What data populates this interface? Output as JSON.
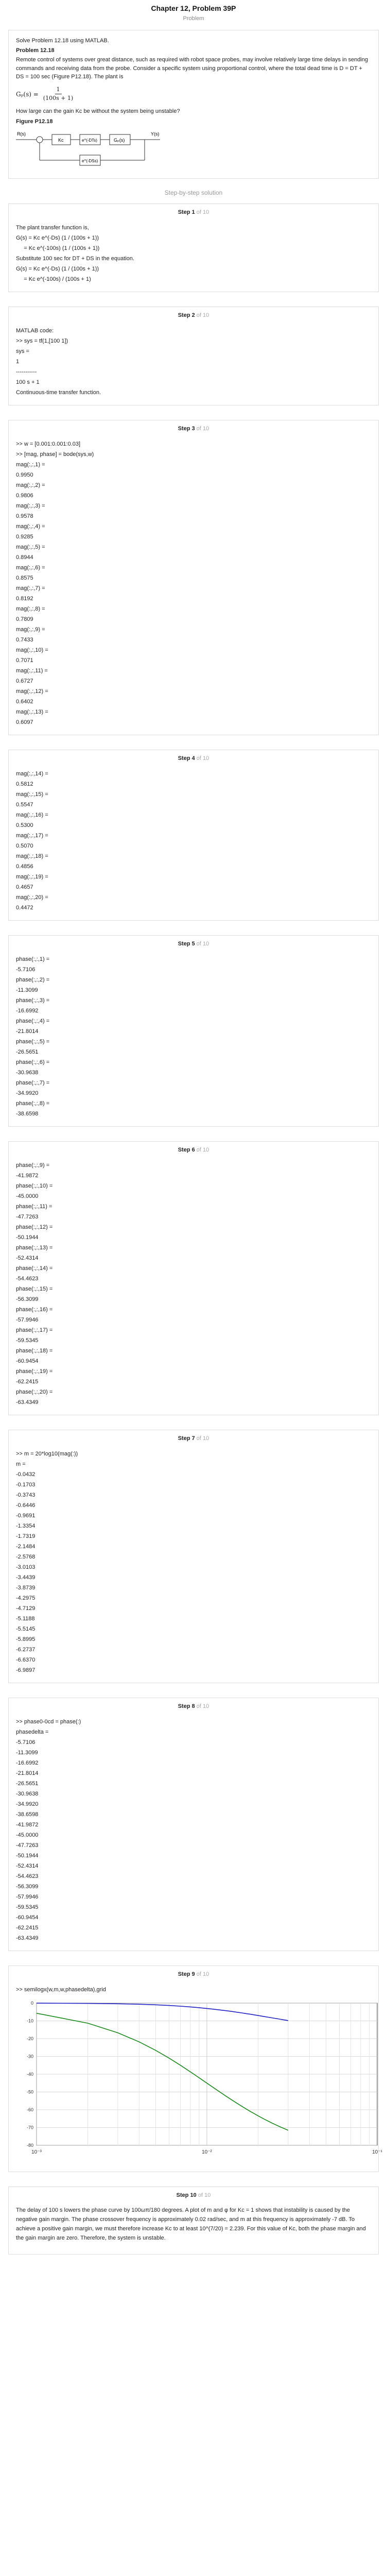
{
  "header": {
    "title": "Chapter 12, Problem 39P",
    "subtitle": "Problem"
  },
  "problem": {
    "intro": "Solve Problem 12.18 using MATLAB.",
    "ref": "Problem 12.18",
    "text": "Remote control of systems over great distance, such as required with robot space probes, may involve relatively large time delays in sending commands and receiving data from the probe. Consider a specific system using proportional control, where the total dead time is D = DT + DS = 100 sec (Figure P12.18). The plant is",
    "eq_lhs": "Gₚ(s) =",
    "eq_num": "1",
    "eq_den": "(100s + 1)",
    "question": "How large can the gain Kc be without the system being unstable?",
    "fig_label": "Figure P12.18",
    "diagram": {
      "rsp": "R(s)",
      "ys": "Y(s)",
      "kc": "Kc",
      "gp": "Gₚ(s)",
      "dt": "e^(-DTs)",
      "ds": "e^(-DSs)"
    }
  },
  "solution_label": "Step-by-step solution",
  "steps": [
    {
      "num": "Step 1",
      "of": "of 10",
      "lines": [
        "The plant transfer function is,",
        "G(s) = Kc e^(-Ds) (1 / (100s + 1))",
        "     = Kc e^(-100s) (1 / (100s + 1))",
        "Substitute 100 sec for DT + DS in the equation.",
        "G(s) = Kc e^(-Ds) (1 / (100s + 1))",
        "     = Kc e^(-100s) / (100s + 1)"
      ]
    },
    {
      "num": "Step 2",
      "of": "of 10",
      "lines": [
        "MATLAB code:",
        ">> sys = tf(1,[100 1])",
        "sys =",
        "1",
        "-----------",
        "100 s + 1",
        "Continuous-time transfer function."
      ]
    },
    {
      "num": "Step 3",
      "of": "of 10",
      "lines": [
        ">> w = [0.001:0.001:0.03]",
        ">> [mag, phase] = bode(sys,w)",
        "mag(:,:,1) =",
        "0.9950",
        "mag(:,:,2) =",
        "0.9806",
        "mag(:,:,3) =",
        "0.9578",
        "mag(:,:,4) =",
        "0.9285",
        "mag(:,:,5) =",
        "0.8944",
        "mag(:,:,6) =",
        "0.8575",
        "mag(:,:,7) =",
        "0.8192",
        "mag(:,:,8) =",
        "0.7809",
        "mag(:,:,9) =",
        "0.7433",
        "mag(:,:,10) =",
        "0.7071",
        "mag(:,:,11) =",
        "0.6727",
        "mag(:,:,12) =",
        "0.6402",
        "mag(:,:,13) =",
        "0.6097"
      ]
    },
    {
      "num": "Step 4",
      "of": "of 10",
      "lines": [
        "mag(:,:,14) =",
        "0.5812",
        "mag(:,:,15) =",
        "0.5547",
        "mag(:,:,16) =",
        "0.5300",
        "mag(:,:,17) =",
        "0.5070",
        "mag(:,:,18) =",
        "0.4856",
        "mag(:,:,19) =",
        "0.4657",
        "mag(:,:,20) =",
        "0.4472"
      ]
    },
    {
      "num": "Step 5",
      "of": "of 10",
      "lines": [
        "phase(:,:,1) =",
        "-5.7106",
        "phase(:,:,2) =",
        "-11.3099",
        "phase(:,:,3) =",
        "-16.6992",
        "phase(:,:,4) =",
        "-21.8014",
        "phase(:,:,5) =",
        "-26.5651",
        "phase(:,:,6) =",
        "-30.9638",
        "phase(:,:,7) =",
        "-34.9920",
        "phase(:,:,8) =",
        "-38.6598"
      ]
    },
    {
      "num": "Step 6",
      "of": "of 10",
      "lines": [
        "phase(:,:,9) =",
        "-41.9872",
        "phase(:,:,10) =",
        "-45.0000",
        "phase(:,:,11) =",
        "-47.7263",
        "phase(:,:,12) =",
        "-50.1944",
        "phase(:,:,13) =",
        "-52.4314",
        "phase(:,:,14) =",
        "-54.4623",
        "phase(:,:,15) =",
        "-56.3099",
        "phase(:,:,16) =",
        "-57.9946",
        "phase(:,:,17) =",
        "-59.5345",
        "phase(:,:,18) =",
        "-60.9454",
        "phase(:,:,19) =",
        "-62.2415",
        "phase(:,:,20) =",
        "-63.4349"
      ]
    },
    {
      "num": "Step 7",
      "of": "of 10",
      "lines": [
        ">> m = 20*log10(mag(:))",
        "m =",
        "-0.0432",
        "-0.1703",
        "-0.3743",
        "-0.6446",
        "-0.9691",
        "-1.3354",
        "-1.7319",
        "-2.1484",
        "-2.5768",
        "-3.0103",
        "-3.4439",
        "-3.8739",
        "-4.2975",
        "-4.7129",
        "-5.1188",
        "-5.5145",
        "-5.8995",
        "-6.2737",
        "-6.6370",
        "-6.9897"
      ]
    },
    {
      "num": "Step 8",
      "of": "of 10",
      "lines": [
        ">> phase0-0cd = phase(:)",
        "phasedelta =",
        "-5.7106",
        "-11.3099",
        "-16.6992",
        "-21.8014",
        "-26.5651",
        "-30.9638",
        "-34.9920",
        "-38.6598",
        "-41.9872",
        "-45.0000",
        "-47.7263",
        "-50.1944",
        "-52.4314",
        "-54.4623",
        "-56.3099",
        "-57.9946",
        "-59.5345",
        "-60.9454",
        "-62.2415",
        "-63.4349"
      ]
    }
  ],
  "step9": {
    "num": "Step 9",
    "of": "of 10",
    "code": ">> semilogx(w,m,w,phasedelta),grid",
    "chart_data": {
      "type": "line",
      "x": [
        0.001,
        0.002,
        0.003,
        0.004,
        0.005,
        0.006,
        0.007,
        0.008,
        0.009,
        0.01,
        0.011,
        0.012,
        0.013,
        0.014,
        0.015,
        0.016,
        0.017,
        0.018,
        0.019,
        0.02,
        0.021,
        0.022,
        0.023,
        0.024,
        0.025,
        0.026,
        0.027,
        0.028,
        0.029,
        0.03
      ],
      "series": [
        {
          "color": "#1f1fc4",
          "values": [
            -0.04,
            -0.17,
            -0.37,
            -0.64,
            -0.97,
            -1.34,
            -1.73,
            -2.15,
            -2.58,
            -3.01,
            -3.44,
            -3.87,
            -4.3,
            -4.71,
            -5.12,
            -5.51,
            -5.9,
            -6.27,
            -6.64,
            -6.99,
            -7.33,
            -7.65,
            -7.96,
            -8.26,
            -8.55,
            -8.82,
            -9.09,
            -9.35,
            -9.59,
            -9.83
          ]
        },
        {
          "color": "#1a8a1a",
          "values": [
            -5.71,
            -11.31,
            -16.7,
            -21.8,
            -26.57,
            -30.96,
            -34.99,
            -38.66,
            -41.99,
            -45.0,
            -47.73,
            -50.19,
            -52.43,
            -54.46,
            -56.31,
            -57.99,
            -59.53,
            -60.95,
            -62.24,
            -63.43,
            -64.54,
            -65.56,
            -66.5,
            -67.38,
            -68.2,
            -68.96,
            -69.68,
            -70.35,
            -70.97,
            -71.57
          ]
        }
      ],
      "xlim": [
        0.001,
        0.1
      ],
      "ylim": [
        -80,
        0
      ],
      "log_x": true,
      "grid": true,
      "yticks": [
        "0",
        "-10",
        "-20",
        "-30",
        "-40",
        "-50",
        "-60",
        "-70",
        "-80"
      ],
      "xticks": [
        "10⁻³",
        "10⁻²",
        "10⁻¹"
      ]
    }
  },
  "step10": {
    "num": "Step 10",
    "of": "of 10",
    "text": "The delay of 100 s lowers the phase curve by 100ωπ/180 degrees. A plot of m and φ for Kc = 1 shows that instability is caused by the negative gain margin. The phase crossover frequency is approximately 0.02 rad/sec, and m at this frequency is approximately -7 dB. To achieve a positive gain margin, we must therefore increase Kc to at least 10^(7/20) = 2.239. For this value of Kc, both the phase margin and the gain margin are zero. Therefore, the system is unstable."
  }
}
